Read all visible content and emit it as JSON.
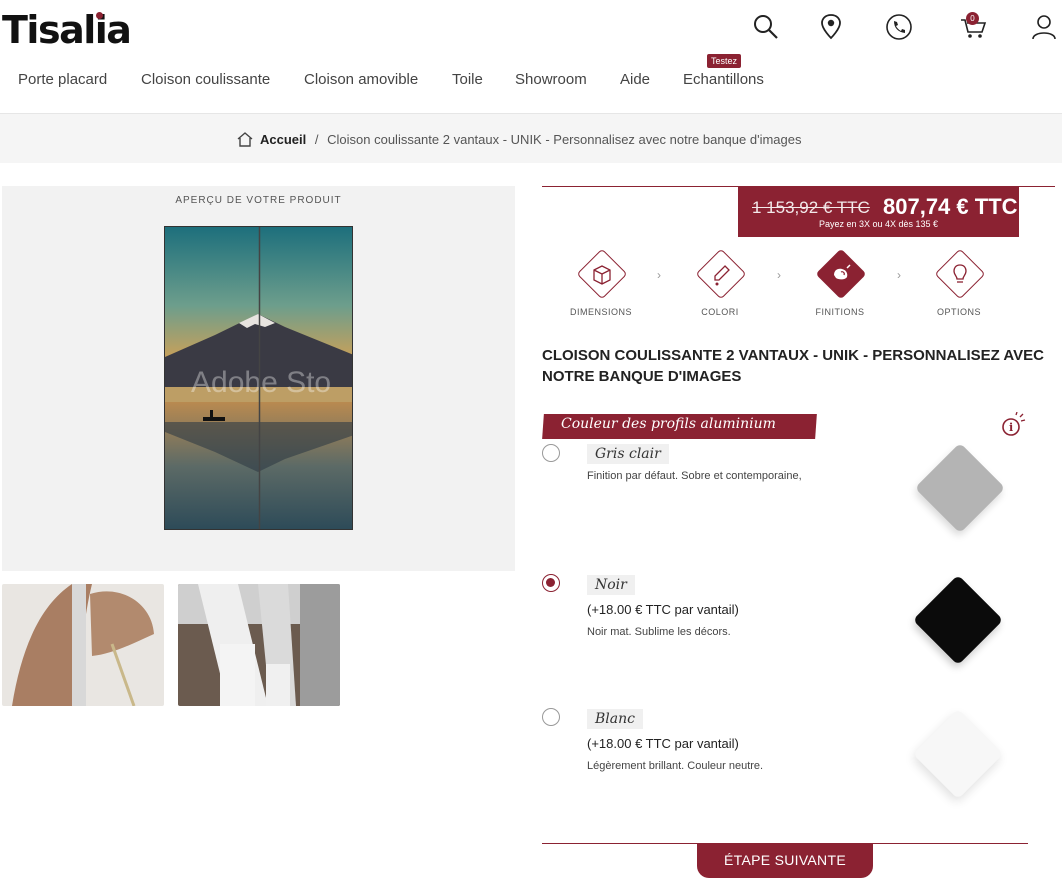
{
  "brand": {
    "logo_text": "Tisalia",
    "accent_color": "#8b2232"
  },
  "header_icons": [
    "search-icon",
    "location-icon",
    "phone-icon",
    "cart-icon",
    "user-icon"
  ],
  "cart": {
    "count": "0"
  },
  "nav": {
    "items": [
      {
        "label": "Porte placard"
      },
      {
        "label": "Cloison coulissante"
      },
      {
        "label": "Cloison amovible"
      },
      {
        "label": "Toile"
      },
      {
        "label": "Showroom"
      },
      {
        "label": "Aide"
      },
      {
        "label": "Echantillons"
      }
    ],
    "badge": "Testez"
  },
  "breadcrumb": {
    "home": "Accueil",
    "separator": "/",
    "current": "Cloison coulissante 2 vantaux - UNIK - Personnalisez avec notre banque d'images"
  },
  "preview": {
    "label": "APERÇU DE VOTRE PRODUIT",
    "watermark": "Adobe Sto"
  },
  "price": {
    "old": "1 153,92 € TTC",
    "new": "807,74 € TTC",
    "payment": "Payez en 3X ou 4X dès 135 €"
  },
  "steps": [
    {
      "label": "DIMENSIONS",
      "icon": "box-icon"
    },
    {
      "label": "COLORI",
      "icon": "dropper-icon"
    },
    {
      "label": "FINITIONS",
      "icon": "finish-icon"
    },
    {
      "label": "OPTIONS",
      "icon": "bulb-icon"
    }
  ],
  "product": {
    "title": "CLOISON COULISSANTE 2 VANTAUX - UNIK - PERSONNALISEZ AVEC NOTRE BANQUE D'IMAGES"
  },
  "section": {
    "title": "Couleur des profils aluminium"
  },
  "options": [
    {
      "name": "Gris clair",
      "price": "",
      "desc": "Finition par défaut. Sobre et contemporaine,",
      "selected": false,
      "color": "#b4b4b4"
    },
    {
      "name": "Noir",
      "price": "(+18.00 € TTC par vantail)",
      "desc": "Noir mat. Sublime les décors.",
      "selected": true,
      "color": "#0b0b0b"
    },
    {
      "name": "Blanc",
      "price": "(+18.00 € TTC par vantail)",
      "desc": "Légèrement brillant. Couleur neutre.",
      "selected": false,
      "color": "#f7f7f7"
    }
  ],
  "next_button": "ÉTAPE SUIVANTE"
}
